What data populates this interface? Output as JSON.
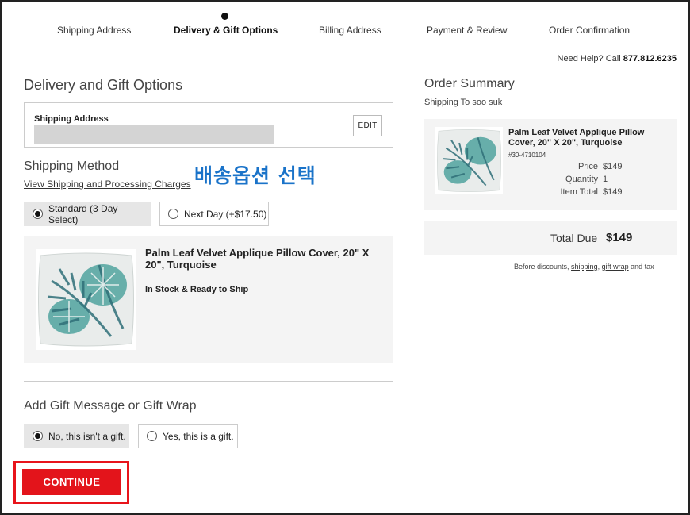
{
  "steps": [
    {
      "label": "Shipping Address"
    },
    {
      "label": "Delivery & Gift Options"
    },
    {
      "label": "Billing Address"
    },
    {
      "label": "Payment & Review"
    },
    {
      "label": "Order Confirmation"
    }
  ],
  "help": {
    "prefix": "Need Help? Call ",
    "phone": "877.812.6235"
  },
  "delivery": {
    "title": "Delivery and Gift Options",
    "shipping_address_label": "Shipping Address",
    "edit_label": "EDIT",
    "shipping_method_title": "Shipping Method",
    "charges_link": "View Shipping and Processing Charges",
    "annotation": "배송옵션 선택",
    "options": [
      {
        "label": "Standard (3 Day Select)",
        "selected": true
      },
      {
        "label": "Next Day (+$17.50)",
        "selected": false
      }
    ],
    "item": {
      "title": "Palm Leaf Velvet Applique Pillow Cover, 20\" X 20\", Turquoise",
      "stock": "In Stock & Ready to Ship"
    }
  },
  "gift": {
    "title": "Add Gift Message or Gift Wrap",
    "options": [
      {
        "label": "No, this isn't a gift.",
        "selected": true
      },
      {
        "label": "Yes, this is a gift.",
        "selected": false
      }
    ]
  },
  "continue_label": "CONTINUE",
  "summary": {
    "title": "Order Summary",
    "shipping_to": "Shipping To soo suk",
    "item_title": "Palm Leaf Velvet Applique Pillow Cover, 20\" X 20\", Turquoise",
    "sku": "#30-4710104",
    "price_label": "Price",
    "price": "$149",
    "qty_label": "Quantity",
    "qty": "1",
    "item_total_label": "Item Total",
    "item_total": "$149",
    "total_label": "Total Due",
    "total": "$149",
    "disclaimer_pre": "Before discounts, ",
    "disclaimer_shipping": "shipping",
    "disclaimer_sep": ", ",
    "disclaimer_giftwrap": "gift wrap",
    "disclaimer_post": " and tax"
  },
  "colors": {
    "accent_red": "#e3141b",
    "annotation_blue": "#1a73c9"
  }
}
